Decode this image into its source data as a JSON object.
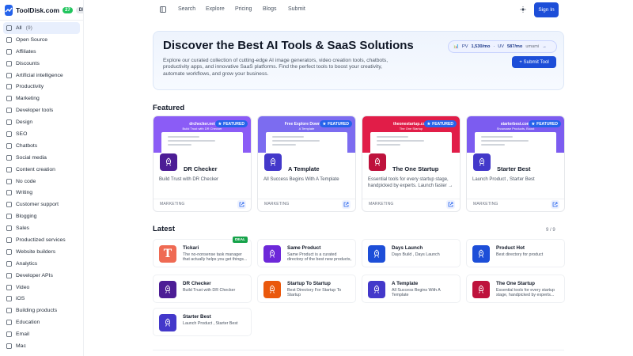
{
  "brand": {
    "name": "ToolDisk.com",
    "badge_count": "27",
    "badge_dr": "DR"
  },
  "sidebar": {
    "items": [
      {
        "label": "All",
        "count": "(9)",
        "icon": "grid-icon",
        "active": true
      },
      {
        "label": "Open Source",
        "icon": "folder-icon"
      },
      {
        "label": "Affiliates",
        "icon": "link-icon"
      },
      {
        "label": "Discounts",
        "icon": "tag-icon"
      },
      {
        "label": "Artificial intelligence",
        "icon": "sparkle-icon"
      },
      {
        "label": "Productivity",
        "icon": "file-icon"
      },
      {
        "label": "Marketing",
        "icon": "megaphone-icon"
      },
      {
        "label": "Developer tools",
        "icon": "code-icon"
      },
      {
        "label": "Design",
        "icon": "pen-icon"
      },
      {
        "label": "SEO",
        "icon": "search-icon"
      },
      {
        "label": "Chatbots",
        "icon": "chat-icon"
      },
      {
        "label": "Social media",
        "icon": "share-icon"
      },
      {
        "label": "Content creation",
        "icon": "edit-icon"
      },
      {
        "label": "No code",
        "icon": "blocks-icon"
      },
      {
        "label": "Writing",
        "icon": "pencil-icon"
      },
      {
        "label": "Customer support",
        "icon": "headset-icon"
      },
      {
        "label": "Blogging",
        "icon": "note-icon"
      },
      {
        "label": "Sales",
        "icon": "cart-icon"
      },
      {
        "label": "Productized services",
        "icon": "box-icon"
      },
      {
        "label": "Website builders",
        "icon": "globe-icon"
      },
      {
        "label": "Analytics",
        "icon": "chart-icon"
      },
      {
        "label": "Developer APIs",
        "icon": "terminal-icon"
      },
      {
        "label": "Video",
        "icon": "video-icon"
      },
      {
        "label": "iOS",
        "icon": "phone-icon"
      },
      {
        "label": "Building products",
        "icon": "tools-icon"
      },
      {
        "label": "Education",
        "icon": "book-icon"
      },
      {
        "label": "Email",
        "icon": "mail-icon"
      },
      {
        "label": "Mac",
        "icon": "laptop-icon"
      }
    ]
  },
  "topnav": {
    "links": [
      "Search",
      "Explore",
      "Pricing",
      "Blogs",
      "Submit"
    ],
    "sign_in": "Sign In"
  },
  "hero": {
    "title": "Discover the Best AI Tools & SaaS Solutions",
    "description": "Explore our curated collection of cutting-edge AI image generators, video creation tools, chatbots, productivity apps, and innovative SaaS platforms. Find the perfect tools to boost your creativity, automate workflows, and grow your business.",
    "stats": {
      "pv_label": "PV",
      "pv_value": "1,530/mo",
      "uv_label": "UV",
      "uv_value": "587/mo",
      "source": "umami"
    },
    "submit_label": "+ Submit Tool"
  },
  "featured": {
    "title": "Featured",
    "badge": "FEATURED",
    "cards": [
      {
        "name": "DR Checker",
        "desc": "Build Trust with DR Checker",
        "tag": "MARKETING",
        "shot_title": "drchecker.net",
        "shot_sub": "Build Trust with DR Checker",
        "shot_color": "#8b5cf6",
        "icon_color": "#4c1d95"
      },
      {
        "name": "A Template",
        "desc": "All Success Begins With A Template",
        "tag": "MARKETING",
        "shot_title": "Free Explore Download",
        "shot_sub": "A Template",
        "shot_color": "#7c6cf0",
        "icon_color": "#4338ca"
      },
      {
        "name": "The One Startup",
        "desc": "Essential tools for every startup stage, handpicked by experts. Launch faster →",
        "tag": "MARKETING",
        "shot_title": "theonestartup.com",
        "shot_sub": "The One Startup",
        "shot_color": "#e11d48",
        "icon_color": "#be123c"
      },
      {
        "name": "Starter Best",
        "desc": "Launch Product , Starter Best",
        "tag": "MARKETING",
        "shot_title": "starterbest.com",
        "shot_sub": "Showcase Products, Boost",
        "shot_color": "#7c5cf0",
        "icon_color": "#4338ca"
      }
    ]
  },
  "latest": {
    "title": "Latest",
    "count": "9 / 9",
    "deal_label": "DEAL",
    "cards": [
      {
        "name": "Tickari",
        "desc": "The no-nonsense task manager that actually helps you get things...",
        "icon_color": "#ef6a53",
        "deal": true
      },
      {
        "name": "Same Product",
        "desc": "Same Product is a curated directory of the best new products, mobile...",
        "icon_color": "#6d28d9"
      },
      {
        "name": "Days Launch",
        "desc": "Days Build , Days Launch",
        "icon_color": "#1d4ed8"
      },
      {
        "name": "Product Hot",
        "desc": "Best directory for product",
        "icon_color": "#1d4ed8"
      },
      {
        "name": "DR Checker",
        "desc": "Build Trust with DR Checker",
        "icon_color": "#4c1d95"
      },
      {
        "name": "Startup To Startup",
        "desc": "Best Directory For Startup To Startup",
        "icon_color": "#ea580c"
      },
      {
        "name": "A Template",
        "desc": "All Success Begins With A Template",
        "icon_color": "#4338ca"
      },
      {
        "name": "The One Startup",
        "desc": "Essential tools for every startup stage, handpicked by experts...",
        "icon_color": "#be123c"
      },
      {
        "name": "Starter Best",
        "desc": "Launch Product , Starter Best",
        "icon_color": "#4338ca"
      }
    ]
  }
}
